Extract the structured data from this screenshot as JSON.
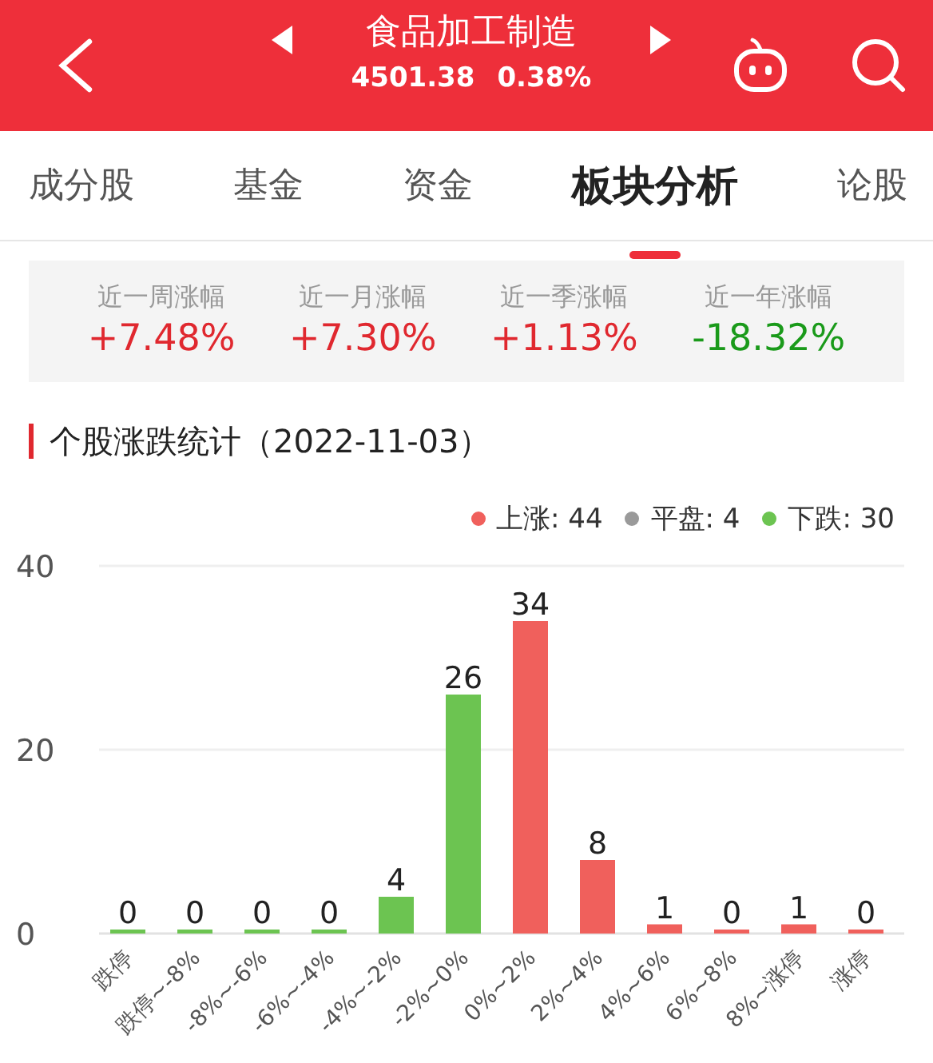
{
  "header": {
    "title": "食品加工制造",
    "price": "4501.38",
    "change": "0.38%"
  },
  "tabs": [
    {
      "label": "成分股",
      "selected": false
    },
    {
      "label": "基金",
      "selected": false
    },
    {
      "label": "资金",
      "selected": false
    },
    {
      "label": "板块分析",
      "selected": true
    },
    {
      "label": "论股",
      "selected": false
    }
  ],
  "performance": [
    {
      "label": "近一周涨幅",
      "value": "+7.48%",
      "kind": "up"
    },
    {
      "label": "近一月涨幅",
      "value": "+7.30%",
      "kind": "up"
    },
    {
      "label": "近一季涨幅",
      "value": "+1.13%",
      "kind": "up"
    },
    {
      "label": "近一年涨幅",
      "value": "-18.32%",
      "kind": "down"
    }
  ],
  "section": {
    "title": "个股涨跌统计（2022-11-03）"
  },
  "legend": [
    {
      "label": "上涨: 44",
      "color": "#f0605c"
    },
    {
      "label": "平盘: 4",
      "color": "#9a9a9a"
    },
    {
      "label": "下跌: 30",
      "color": "#6cc451"
    }
  ],
  "chart_data": {
    "type": "bar",
    "data_labels": true,
    "ylim": [
      0,
      40
    ],
    "yticks": [
      0,
      20,
      40
    ],
    "categories": [
      "跌停",
      "跌停~-8%",
      "-8%~-6%",
      "-6%~-4%",
      "-4%~-2%",
      "-2%~0%",
      "0%~2%",
      "2%~4%",
      "4%~6%",
      "6%~8%",
      "8%~涨停",
      "涨停"
    ],
    "series": [
      {
        "color": "#6cc451",
        "values": [
          0,
          0,
          0,
          0,
          4,
          26,
          null,
          null,
          null,
          null,
          null,
          null
        ]
      },
      {
        "color": "#f0605c",
        "values": [
          null,
          null,
          null,
          null,
          null,
          null,
          34,
          8,
          1,
          0,
          1,
          0
        ]
      }
    ]
  }
}
